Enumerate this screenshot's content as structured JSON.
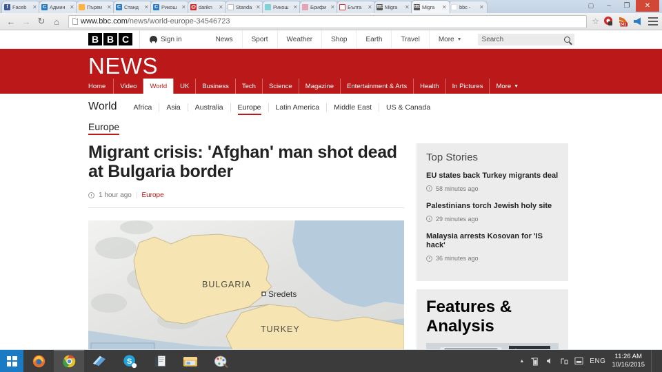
{
  "browser": {
    "tabs": [
      {
        "label": "Faceb",
        "favicon": "facebook-icon",
        "fav_class": "fav-fb",
        "fav_glyph": "f",
        "active": false
      },
      {
        "label": "Админ",
        "favicon": "chrome-app-icon",
        "fav_class": "fav-c",
        "fav_glyph": "C",
        "active": false
      },
      {
        "label": "Първи",
        "favicon": "flame-icon",
        "fav_class": "fav-fire",
        "fav_glyph": "",
        "active": false
      },
      {
        "label": "Станд",
        "favicon": "chrome-app-icon",
        "fav_class": "fav-c",
        "fav_glyph": "C",
        "active": false
      },
      {
        "label": "Рикош",
        "favicon": "chrome-app-icon",
        "fav_class": "fav-c",
        "fav_glyph": "C",
        "active": false
      },
      {
        "label": "darikn",
        "favicon": "darik-icon",
        "fav_class": "fav-dark",
        "fav_glyph": "@",
        "active": false
      },
      {
        "label": "Standa",
        "favicon": "blank-page-icon",
        "fav_class": "fav-page",
        "fav_glyph": "",
        "active": false
      },
      {
        "label": "Рикош",
        "favicon": "teal-circle-icon",
        "fav_class": "fav-teal",
        "fav_glyph": "",
        "active": false
      },
      {
        "label": "Брифи",
        "favicon": "pink-icon",
        "fav_class": "fav-pink",
        "fav_glyph": "",
        "active": false
      },
      {
        "label": "Бълга",
        "favicon": "bulgaria-icon",
        "fav_class": "fav-bulg",
        "fav_glyph": "Д",
        "active": false
      },
      {
        "label": "Migra",
        "favicon": "bbc-icon",
        "fav_class": "fav-mig",
        "fav_glyph": "BBC",
        "active": false
      },
      {
        "label": "Migra",
        "favicon": "bbc-icon",
        "fav_class": "fav-mig",
        "fav_glyph": "BBC",
        "active": true
      },
      {
        "label": "bbc -",
        "favicon": "google-icon",
        "fav_class": "fav-g",
        "fav_glyph": "G",
        "active": false
      }
    ],
    "tab_close_glyph": "✕",
    "window_controls": {
      "user_label": "▢",
      "minimize": "–",
      "maximize": "❐",
      "close": "✕"
    },
    "toolbar": {
      "back": "←",
      "forward": "→",
      "reload": "↻",
      "home": "⌂",
      "url_domain": "www.bbc.com",
      "url_path": "/news/world-europe-34546723",
      "bookmark_star": "☆",
      "extensions": [
        {
          "name": "red-circle-extension-icon",
          "badge": ""
        },
        {
          "name": "rss-feed-extension-icon",
          "badge": "241"
        },
        {
          "name": "megaphone-extension-icon",
          "badge": ""
        }
      ],
      "menu": "chrome-menu-icon"
    }
  },
  "bbc": {
    "logo_letters": [
      "B",
      "B",
      "C"
    ],
    "sign_in": "Sign in",
    "top_nav": [
      "News",
      "Sport",
      "Weather",
      "Shop",
      "Earth",
      "Travel"
    ],
    "top_nav_more": "More",
    "search_placeholder": "Search",
    "brand_word": "NEWS",
    "brand_color": "#bb1919",
    "section_nav": [
      "Home",
      "Video",
      "World",
      "UK",
      "Business",
      "Tech",
      "Science",
      "Magazine",
      "Entertainment & Arts",
      "Health",
      "In Pictures"
    ],
    "section_nav_more": "More",
    "section_nav_active": "World",
    "world_title": "World",
    "world_nav": [
      "Africa",
      "Asia",
      "Australia",
      "Europe",
      "Latin America",
      "Middle East",
      "US & Canada"
    ],
    "world_nav_active": "Europe",
    "breadcrumb": "Europe"
  },
  "article": {
    "headline": "Migrant crisis: 'Afghan' man shot dead at Bulgaria border",
    "timestamp": "1 hour ago",
    "section": "Europe",
    "map": {
      "country_1": "BULGARIA",
      "country_2": "TURKEY",
      "city": "Sredets"
    }
  },
  "sidebar": {
    "top_stories_title": "Top Stories",
    "top_stories": [
      {
        "title": "EU states back Turkey migrants deal",
        "time": "58 minutes ago"
      },
      {
        "title": "Palestinians torch Jewish holy site",
        "time": "29 minutes ago"
      },
      {
        "title": "Malaysia arrests Kosovan for 'IS hack'",
        "time": "36 minutes ago"
      }
    ],
    "features_title": "Features & Analysis"
  },
  "taskbar": {
    "start": "windows-start-icon",
    "apps": [
      {
        "name": "firefox-icon",
        "active": false
      },
      {
        "name": "chrome-icon",
        "active": true
      },
      {
        "name": "reader-icon",
        "active": false
      },
      {
        "name": "skype-icon",
        "active": false
      },
      {
        "name": "scanner-icon",
        "active": false
      },
      {
        "name": "file-explorer-icon",
        "active": false
      },
      {
        "name": "paint-icon",
        "active": false
      }
    ],
    "tray": {
      "chevron": "▲",
      "icons": [
        "battery-icon",
        "volume-icon",
        "network-icon",
        "action-center-icon"
      ],
      "language": "ENG",
      "time": "11:26 AM",
      "date": "10/16/2015"
    }
  }
}
